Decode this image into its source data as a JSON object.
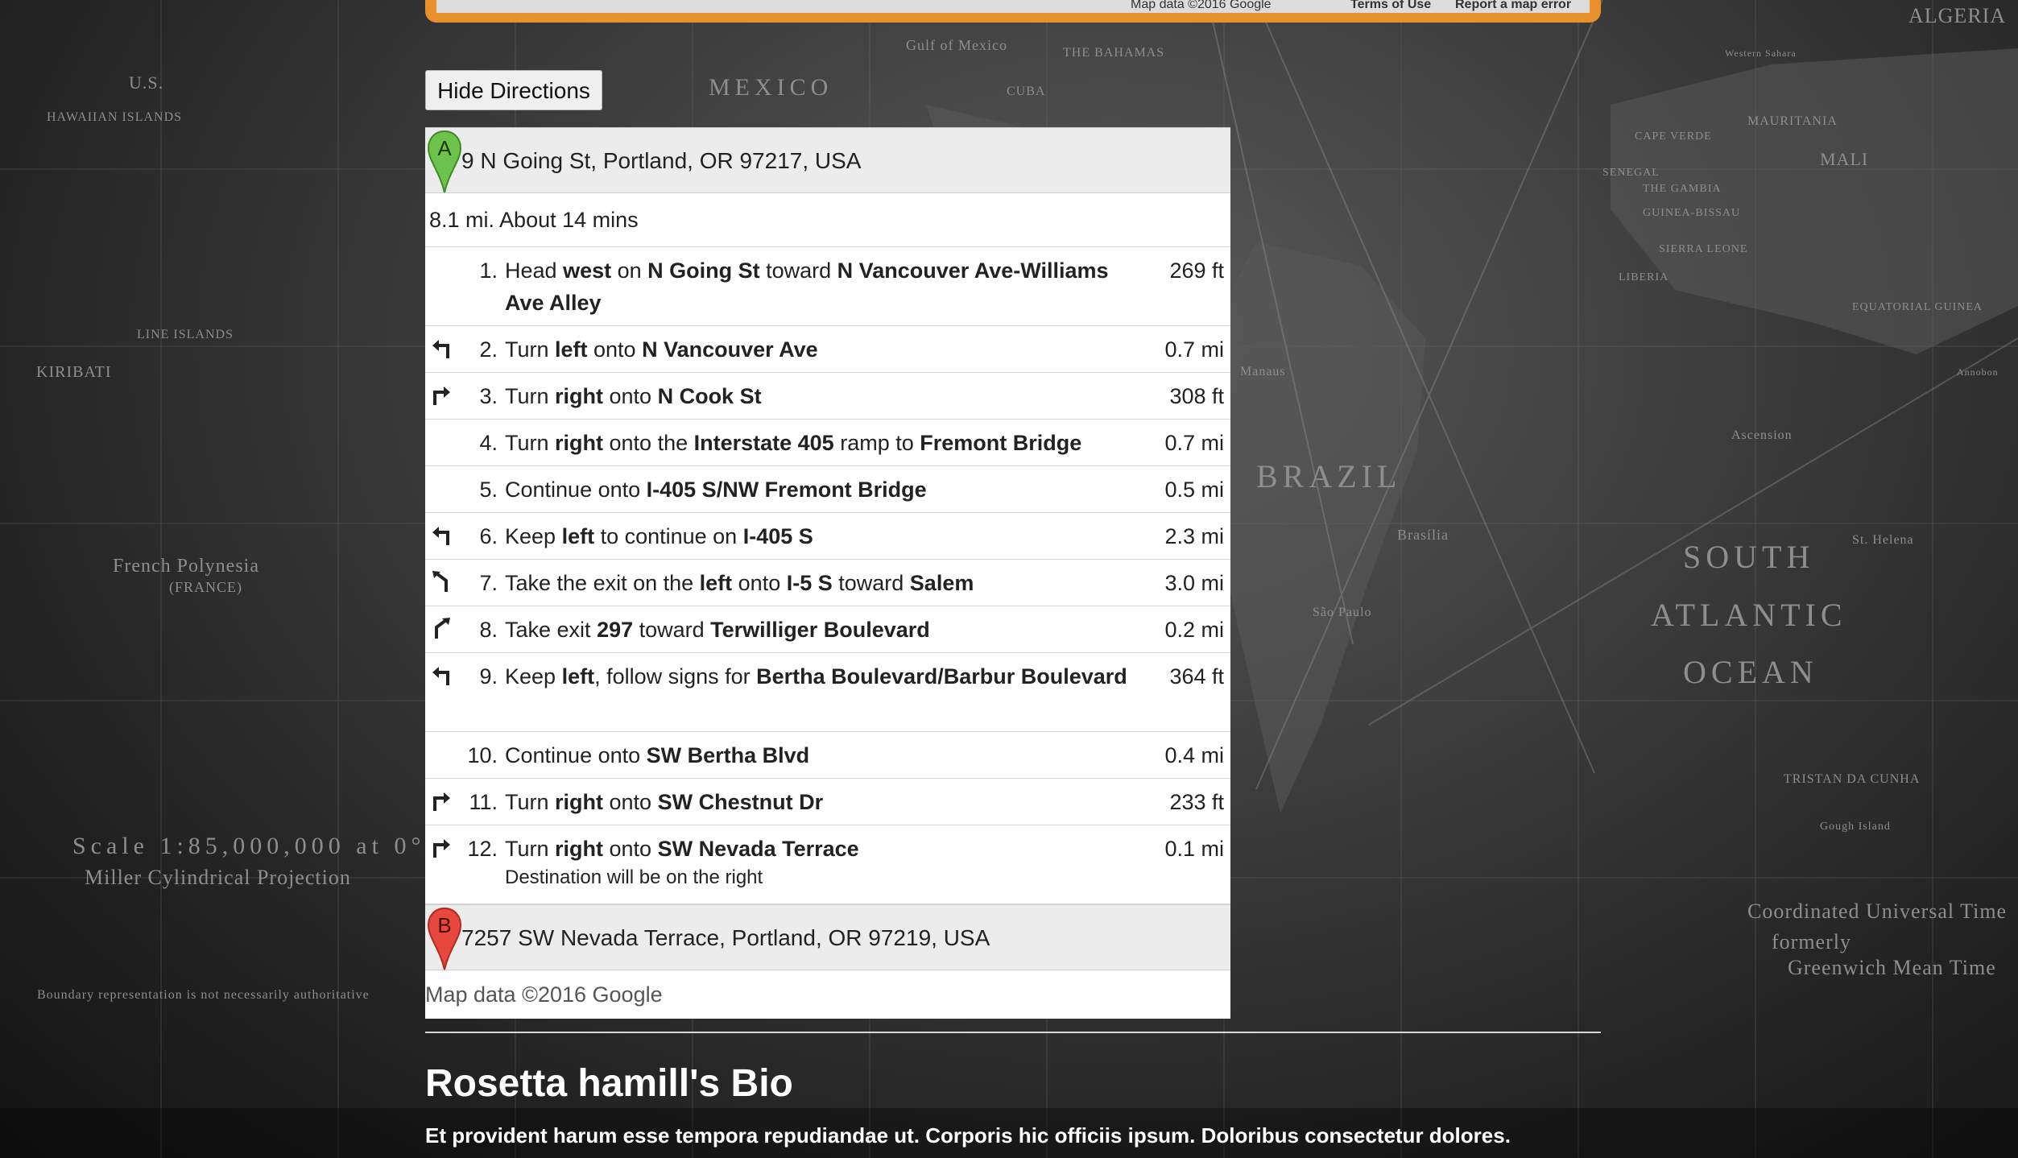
{
  "map_embed": {
    "attribution": "Map data ©2016 Google",
    "terms": "Terms of Use",
    "report": "Report a map error"
  },
  "hide_directions_label": "Hide Directions",
  "origin": {
    "marker": "A",
    "address": "9 N Going St, Portland, OR 97217, USA",
    "marker_color": "#6cc24a"
  },
  "summary": "8.1 mi. About 14 mins",
  "steps": [
    {
      "num": "1.",
      "icon": "",
      "dist": "269 ft",
      "parts": [
        [
          "Head ",
          0
        ],
        [
          "west",
          1
        ],
        [
          " on ",
          0
        ],
        [
          "N Going St",
          1
        ],
        [
          " toward ",
          0
        ],
        [
          "N Vancouver Ave-Williams Ave Alley",
          1
        ]
      ]
    },
    {
      "num": "2.",
      "icon": "turn-left-icon",
      "dist": "0.7 mi",
      "parts": [
        [
          "Turn ",
          0
        ],
        [
          "left",
          1
        ],
        [
          " onto ",
          0
        ],
        [
          "N Vancouver Ave",
          1
        ]
      ]
    },
    {
      "num": "3.",
      "icon": "turn-right-icon",
      "dist": "308 ft",
      "parts": [
        [
          "Turn ",
          0
        ],
        [
          "right",
          1
        ],
        [
          " onto ",
          0
        ],
        [
          "N Cook St",
          1
        ]
      ]
    },
    {
      "num": "4.",
      "icon": "",
      "dist": "0.7 mi",
      "parts": [
        [
          "Turn ",
          0
        ],
        [
          "right",
          1
        ],
        [
          " onto the ",
          0
        ],
        [
          "Interstate 405",
          1
        ],
        [
          " ramp to ",
          0
        ],
        [
          "Fremont Bridge",
          1
        ]
      ]
    },
    {
      "num": "5.",
      "icon": "",
      "dist": "0.5 mi",
      "parts": [
        [
          "Continue onto ",
          0
        ],
        [
          "I-405 S/NW Fremont Bridge",
          1
        ]
      ]
    },
    {
      "num": "6.",
      "icon": "keep-left-icon",
      "dist": "2.3 mi",
      "parts": [
        [
          "Keep ",
          0
        ],
        [
          "left",
          1
        ],
        [
          " to continue on ",
          0
        ],
        [
          "I-405 S",
          1
        ]
      ]
    },
    {
      "num": "7.",
      "icon": "ramp-left-icon",
      "dist": "3.0 mi",
      "parts": [
        [
          "Take the exit on the ",
          0
        ],
        [
          "left",
          1
        ],
        [
          " onto ",
          0
        ],
        [
          "I-5 S",
          1
        ],
        [
          " toward ",
          0
        ],
        [
          "Salem",
          1
        ]
      ]
    },
    {
      "num": "8.",
      "icon": "ramp-right-icon",
      "dist": "0.2 mi",
      "parts": [
        [
          "Take exit ",
          0
        ],
        [
          "297",
          1
        ],
        [
          " toward ",
          0
        ],
        [
          "Terwilliger Boulevard",
          1
        ]
      ]
    },
    {
      "num": "9.",
      "icon": "keep-left-icon",
      "dist": "364 ft",
      "parts": [
        [
          "Keep ",
          0
        ],
        [
          "left",
          1
        ],
        [
          ", follow signs for ",
          0
        ],
        [
          "Bertha Boulevard/Barbur Boulevard",
          1
        ]
      ]
    },
    {
      "num": "10.",
      "icon": "",
      "dist": "0.4 mi",
      "parts": [
        [
          "Continue onto ",
          0
        ],
        [
          "SW Bertha Blvd",
          1
        ]
      ]
    },
    {
      "num": "11.",
      "icon": "turn-right-icon",
      "dist": "233 ft",
      "parts": [
        [
          "Turn ",
          0
        ],
        [
          "right",
          1
        ],
        [
          " onto ",
          0
        ],
        [
          "SW Chestnut Dr",
          1
        ]
      ]
    },
    {
      "num": "12.",
      "icon": "turn-right-icon",
      "dist": "0.1 mi",
      "parts": [
        [
          "Turn ",
          0
        ],
        [
          "right",
          1
        ],
        [
          " onto ",
          0
        ],
        [
          "SW Nevada Terrace",
          1
        ]
      ],
      "note": "Destination will be on the right"
    }
  ],
  "destination": {
    "marker": "B",
    "address": "7257 SW Nevada Terrace, Portland, OR 97219, USA",
    "marker_color": "#e8473e"
  },
  "copyright": "Map data ©2016 Google",
  "bio": {
    "title": "Rosetta hamill's Bio",
    "text": "Et provident harum esse tempora repudiandae ut. Corporis hic officiis ipsum. Doloribus consectetur dolores."
  },
  "background_map_labels": [
    "MEXICO",
    "Gulf of Mexico",
    "THE BAHAMAS",
    "CUBA",
    "U.S.",
    "HAWAIIAN ISLANDS",
    "KIRIBATI",
    "LINE ISLANDS",
    "French Polynesia",
    "(FRANCE)",
    "BRAZIL",
    "Brasília",
    "São Paulo",
    "SOUTH",
    "ATLANTIC",
    "OCEAN",
    "ALGERIA",
    "MAURITANIA",
    "MALI",
    "CAPE VERDE",
    "SENEGAL",
    "THE GAMBIA",
    "GUINEA-BISSAU",
    "SIERRA LEONE",
    "LIBERIA",
    "EQUATORIAL GUINEA",
    "Ascension",
    "St. Helena",
    "TRISTAN DA CUNHA",
    "Gough Island",
    "Scale 1:85,000,000 at 0°",
    "Miller Cylindrical Projection",
    "Coordinated Universal Time",
    "formerly",
    "Greenwich Mean Time",
    "Manaus",
    "Western Sahara",
    "Annobon",
    "Boundary representation is not necessarily authoritative"
  ]
}
